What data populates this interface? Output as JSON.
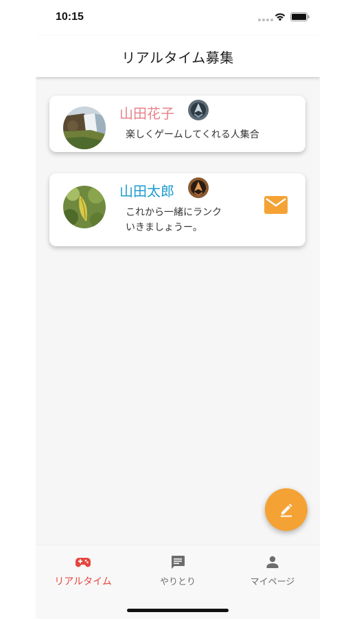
{
  "status_bar": {
    "time": "10:15"
  },
  "app_bar": {
    "title": "リアルタイム募集"
  },
  "posts": [
    {
      "name": "山田花子",
      "message_lines": [
        "楽しくゲームしてくれる人集合"
      ],
      "name_color": "#e8828b",
      "avatar": "waterfall-photo",
      "badge": "rank-emblem-icon",
      "has_mail": false
    },
    {
      "name": "山田太郎",
      "message_lines": [
        "これから一緒にランク",
        "いきましょうー。"
      ],
      "name_color": "#1b9bcf",
      "avatar": "leaf-photo",
      "badge": "rank-emblem-icon",
      "has_mail": true
    }
  ],
  "fab": {
    "icon": "pencil-icon",
    "color": "#f5a235"
  },
  "bottom_nav": {
    "items": [
      {
        "label": "リアルタイム",
        "icon": "gamepad-icon",
        "active": true
      },
      {
        "label": "やりとり",
        "icon": "chat-icon",
        "active": false
      },
      {
        "label": "マイページ",
        "icon": "person-icon",
        "active": false
      }
    ],
    "active_color": "#e6463f"
  }
}
